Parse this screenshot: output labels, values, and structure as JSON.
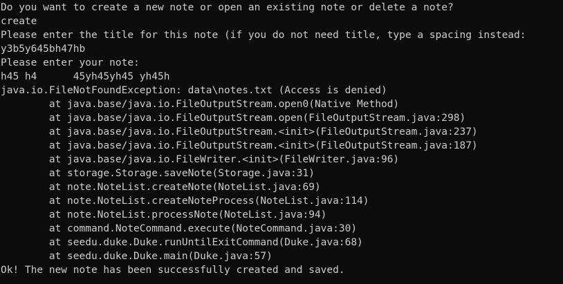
{
  "terminal": {
    "background": "#0c0c0c",
    "foreground": "#cccccc",
    "lines": [
      "Do you want to create a new note or open an existing note or delete a note?",
      "create",
      "Please enter the title for this note (if you do not need title, type a spacing instead:",
      "y3b5y645bh47hb",
      "Please enter your note:",
      "h45 h4      45yh45yh45 yh45h",
      "java.io.FileNotFoundException: data\\notes.txt (Access is denied)",
      "        at java.base/java.io.FileOutputStream.open0(Native Method)",
      "        at java.base/java.io.FileOutputStream.open(FileOutputStream.java:298)",
      "        at java.base/java.io.FileOutputStream.<init>(FileOutputStream.java:237)",
      "        at java.base/java.io.FileOutputStream.<init>(FileOutputStream.java:187)",
      "        at java.base/java.io.FileWriter.<init>(FileWriter.java:96)",
      "        at storage.Storage.saveNote(Storage.java:31)",
      "        at note.NoteList.createNote(NoteList.java:69)",
      "        at note.NoteList.createNoteProcess(NoteList.java:114)",
      "        at note.NoteList.processNote(NoteList.java:94)",
      "        at command.NoteCommand.execute(NoteCommand.java:30)",
      "        at seedu.duke.Duke.runUntilExitCommand(Duke.java:68)",
      "        at seedu.duke.Duke.main(Duke.java:57)",
      "Ok! The new note has been successfully created and saved."
    ]
  }
}
